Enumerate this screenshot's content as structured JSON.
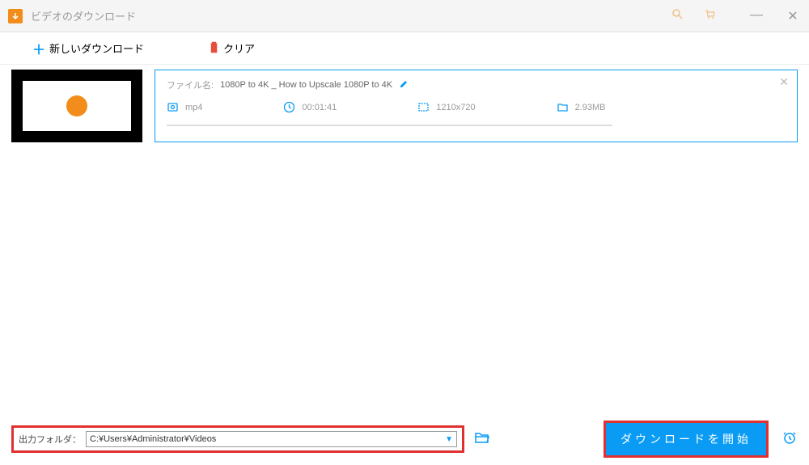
{
  "window": {
    "title": "ビデオのダウンロード"
  },
  "toolbar": {
    "new_download": "新しいダウンロード",
    "clear": "クリア"
  },
  "item": {
    "filename_label": "ファイル名:",
    "filename": "1080P to 4K _ How to Upscale 1080P to 4K",
    "format": "mp4",
    "duration": "00:01:41",
    "resolution": "1210x720",
    "size": "2.93MB"
  },
  "footer": {
    "output_label": "出力フォルダ：",
    "output_path": "C:¥Users¥Administrator¥Videos",
    "start_button": "ダウンロードを開始"
  }
}
